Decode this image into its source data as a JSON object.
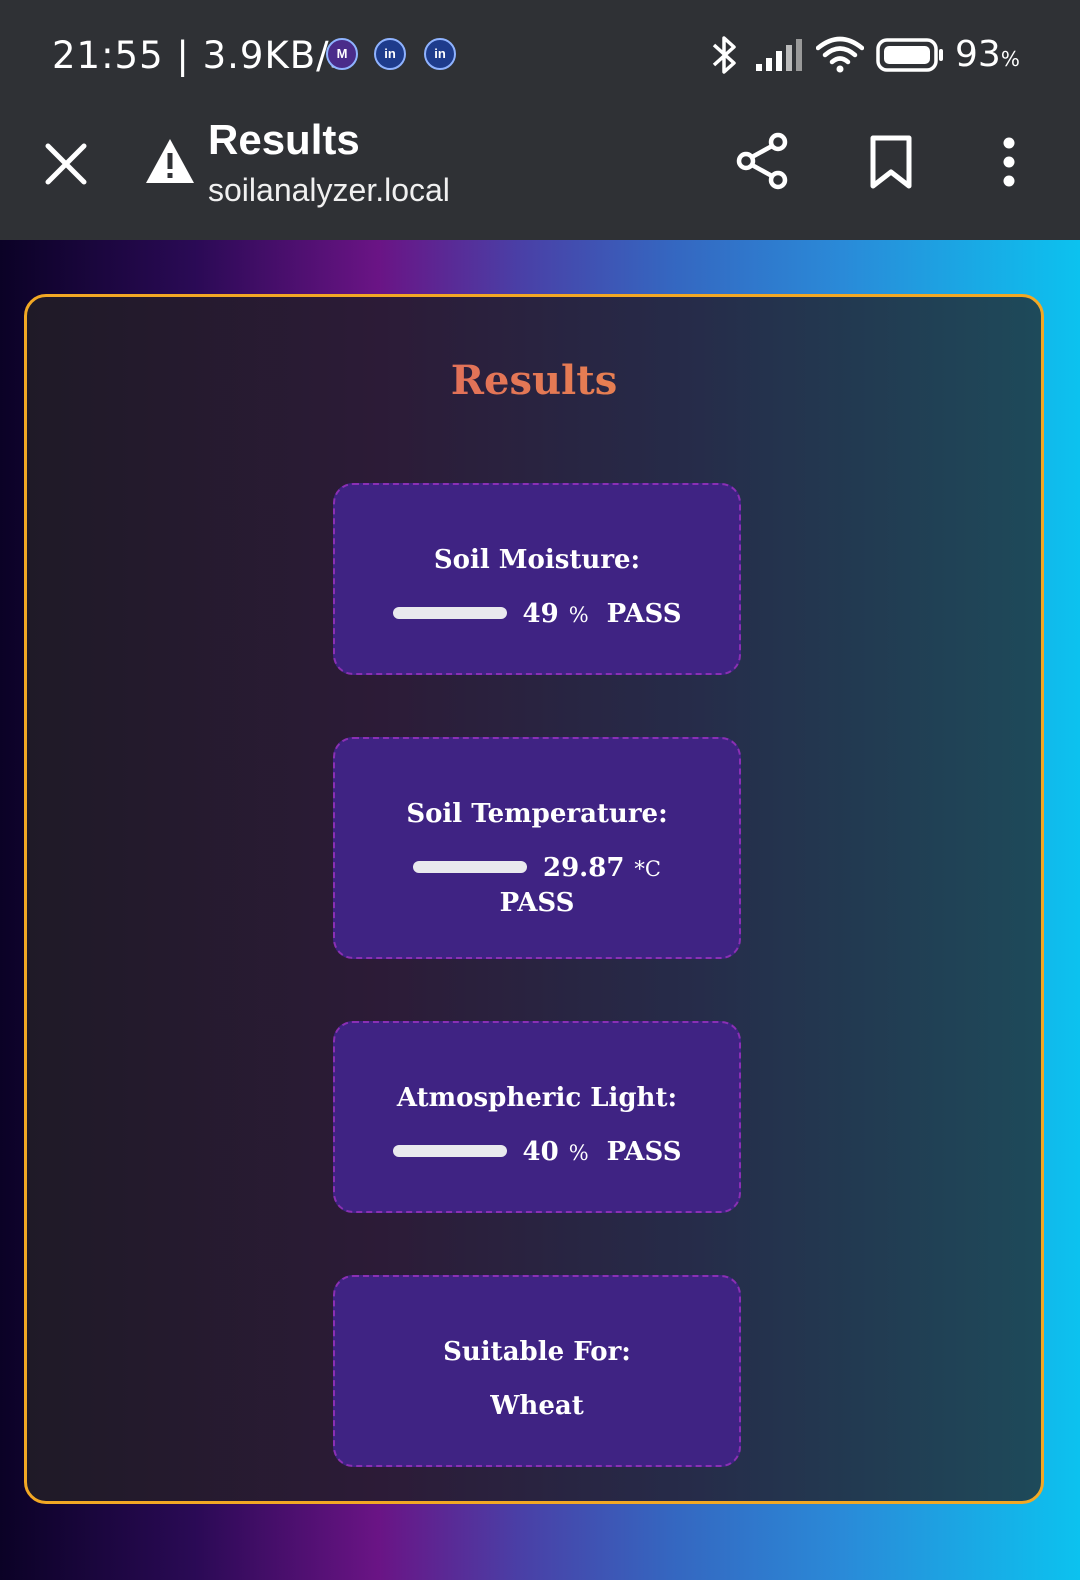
{
  "status_bar": {
    "time_speed": "21:55 | 3.9KB/s",
    "app_icons": [
      "M",
      "in",
      "in"
    ],
    "battery_percent": "93",
    "battery_unit": "%",
    "icons": [
      "bluetooth-icon",
      "signal-icon",
      "wifi-icon",
      "battery-icon"
    ]
  },
  "toolbar": {
    "title": "Results",
    "url": "soilanalyzer.local",
    "icons": [
      "close-icon",
      "warning-icon",
      "share-icon",
      "bookmark-icon",
      "more-vert-icon"
    ]
  },
  "page": {
    "title": "Results",
    "border_color": "#f2a824",
    "title_color": "#e06a4c"
  },
  "metrics": [
    {
      "label": "Soil Moisture:",
      "value": "49",
      "unit": "%",
      "status": "PASS",
      "level_percent": 49
    },
    {
      "label": "Soil Temperature:",
      "value": "29.87",
      "unit": "*C",
      "status": "PASS",
      "level_percent": 30
    },
    {
      "label": "Atmospheric Light:",
      "value": "40",
      "unit": "%",
      "status": "PASS",
      "level_percent": 40
    }
  ],
  "suitable": {
    "label": "Suitable For:",
    "value": "Wheat"
  },
  "colors": {
    "bar_fill": "#177a17",
    "box_bg": "#3f2383",
    "box_border": "#8a2fb5"
  }
}
